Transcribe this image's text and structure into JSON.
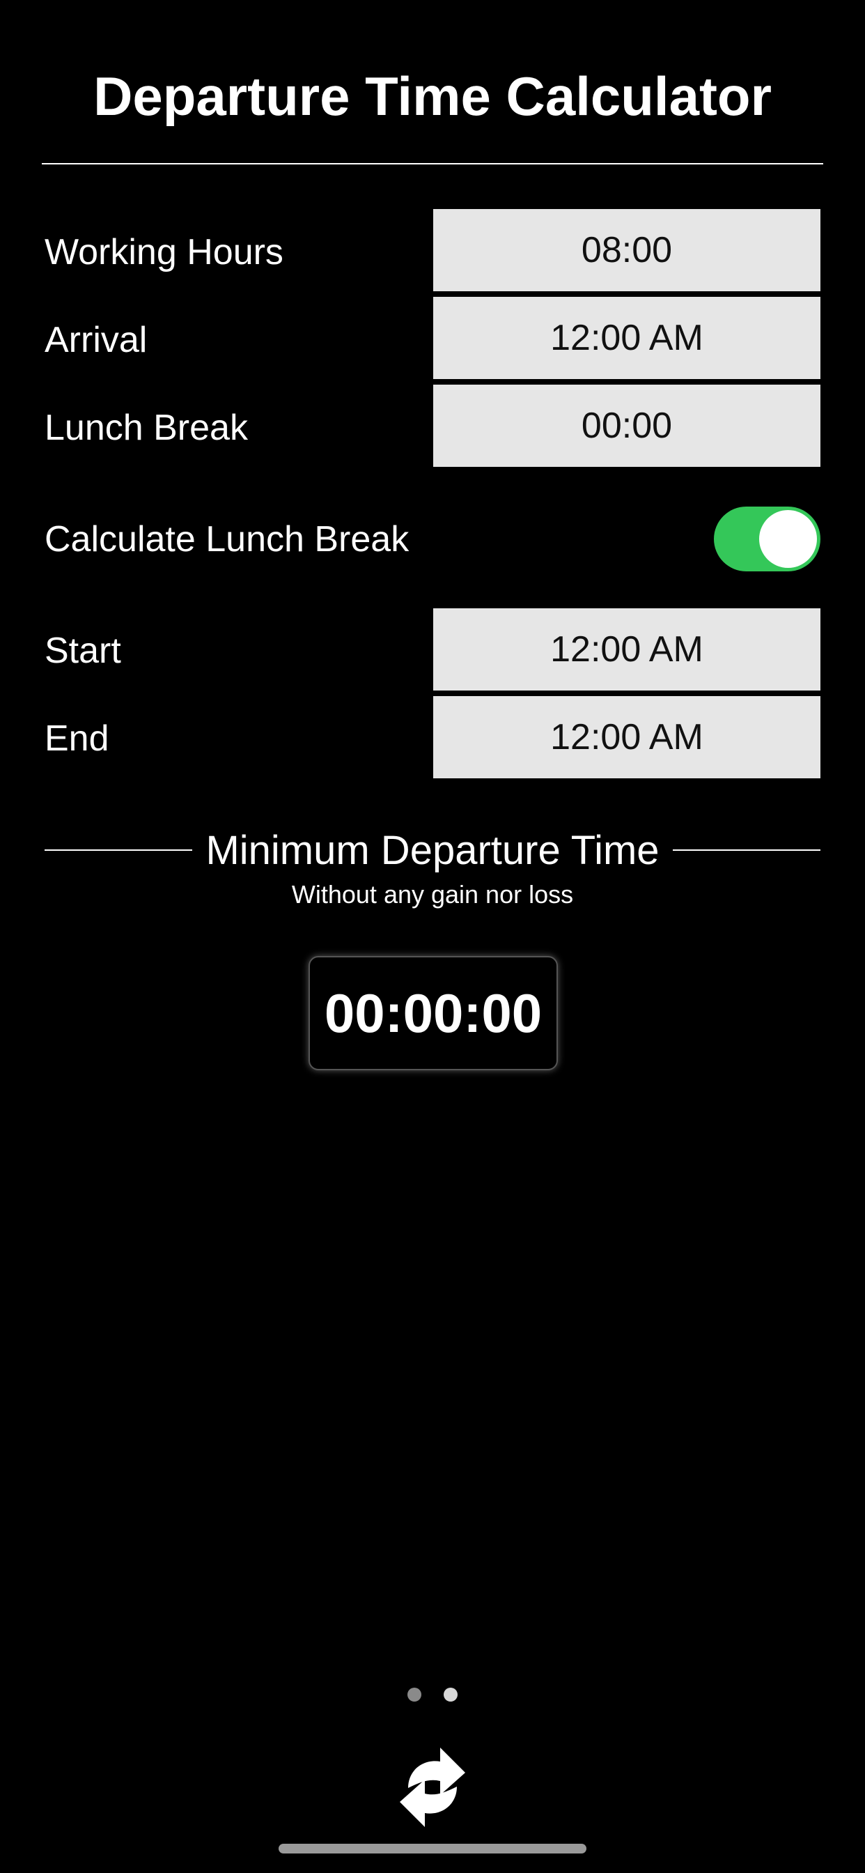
{
  "header": {
    "title": "Departure Time Calculator"
  },
  "form": {
    "working_hours": {
      "label": "Working Hours",
      "value": "08:00"
    },
    "arrival": {
      "label": "Arrival",
      "value": "12:00 AM"
    },
    "lunch_break": {
      "label": "Lunch Break",
      "value": "00:00"
    },
    "calculate_lunch": {
      "label": "Calculate Lunch Break",
      "enabled": true,
      "color": "#34c759"
    },
    "start": {
      "label": "Start",
      "value": "12:00 AM"
    },
    "end": {
      "label": "End",
      "value": "12:00 AM"
    }
  },
  "result": {
    "title": "Minimum Departure Time",
    "subtitle": "Without any gain nor loss",
    "value": "00:00:00"
  },
  "pager": {
    "pages": 2,
    "current": 2
  },
  "footer": {
    "icon": "refresh-icon"
  }
}
